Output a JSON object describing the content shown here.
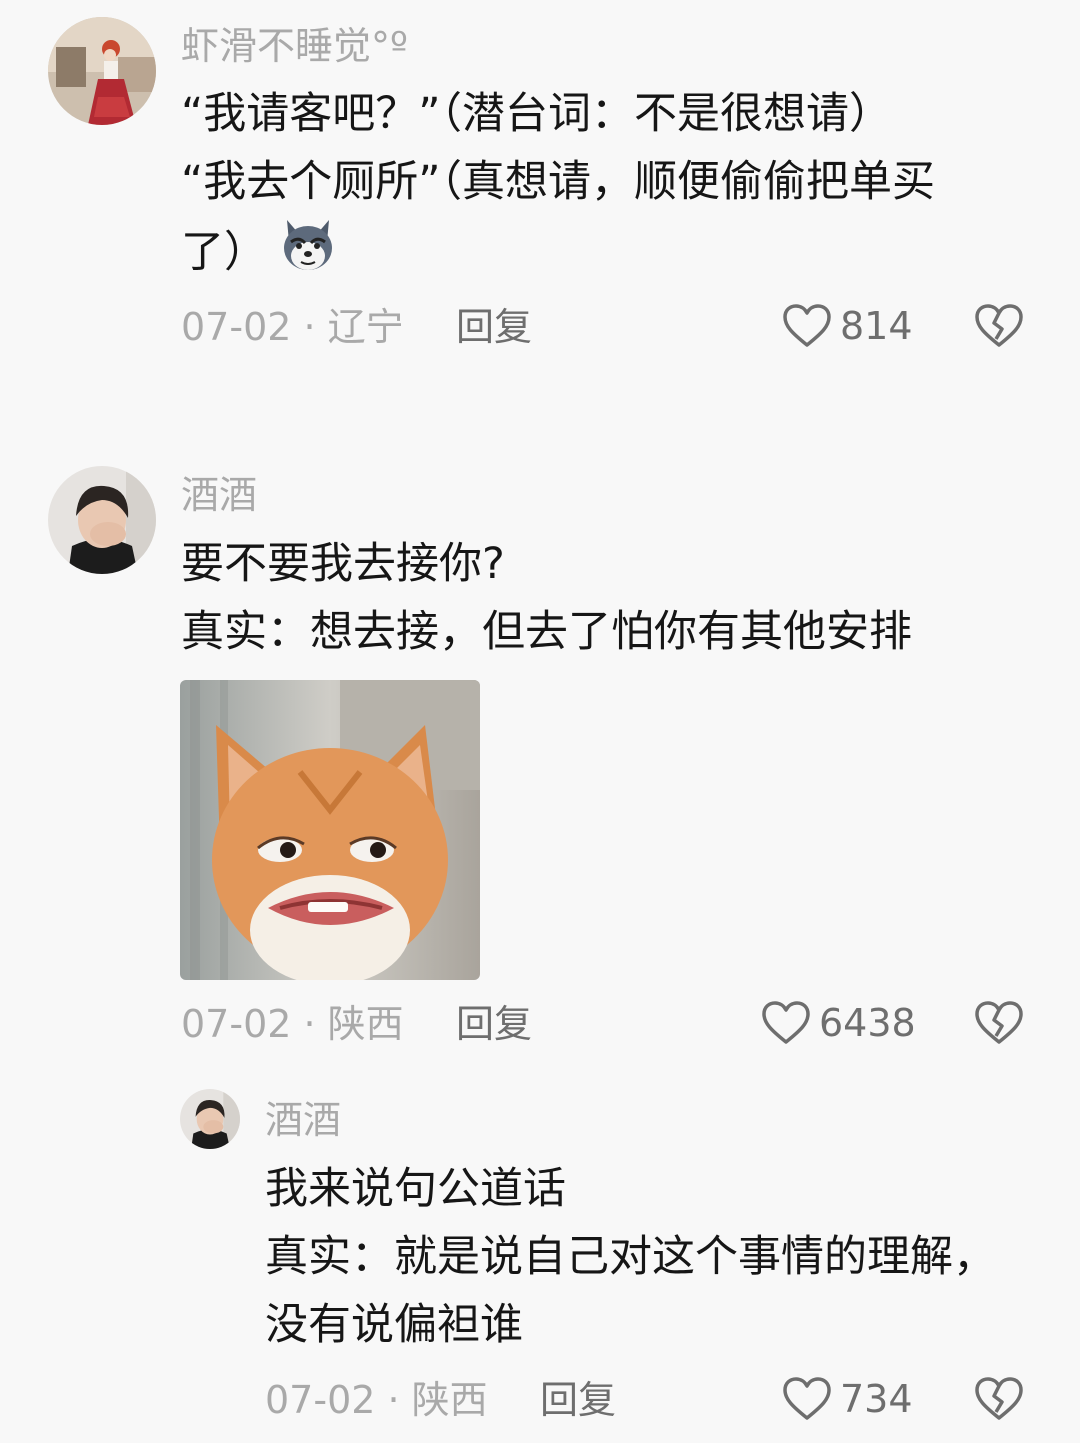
{
  "comments": [
    {
      "username": "虾滑不睡觉°º",
      "lines": [
        "“我请客吧？”（潜台词：不是很想请）",
        "“我去个厕所”（真想请，顺便偷偷把单买",
        "了）"
      ],
      "emoji": "husky-emoji",
      "date_location": "07-02 · 辽宁",
      "reply_label": "回复",
      "likes": "814"
    },
    {
      "username": "酒酒",
      "lines": [
        "要不要我去接你?",
        "真实：想去接，但去了怕你有其他安排"
      ],
      "sticker": "cat-meme-sticker",
      "date_location": "07-02 · 陕西",
      "reply_label": "回复",
      "likes": "6438"
    },
    {
      "username": "酒酒",
      "lines": [
        "我来说句公道话",
        "真实：就是说自己对这个事情的理解，",
        "没有说偏袒谁"
      ],
      "date_location": "07-02 · 陕西",
      "reply_label": "回复",
      "likes": "734"
    }
  ],
  "icons": {
    "like": "heart-outline-icon",
    "dislike": "broken-heart-icon"
  },
  "colors": {
    "background": "#f8f8f8",
    "text": "#161616",
    "muted": "#a9a9a9",
    "action": "#6e6e6e"
  }
}
